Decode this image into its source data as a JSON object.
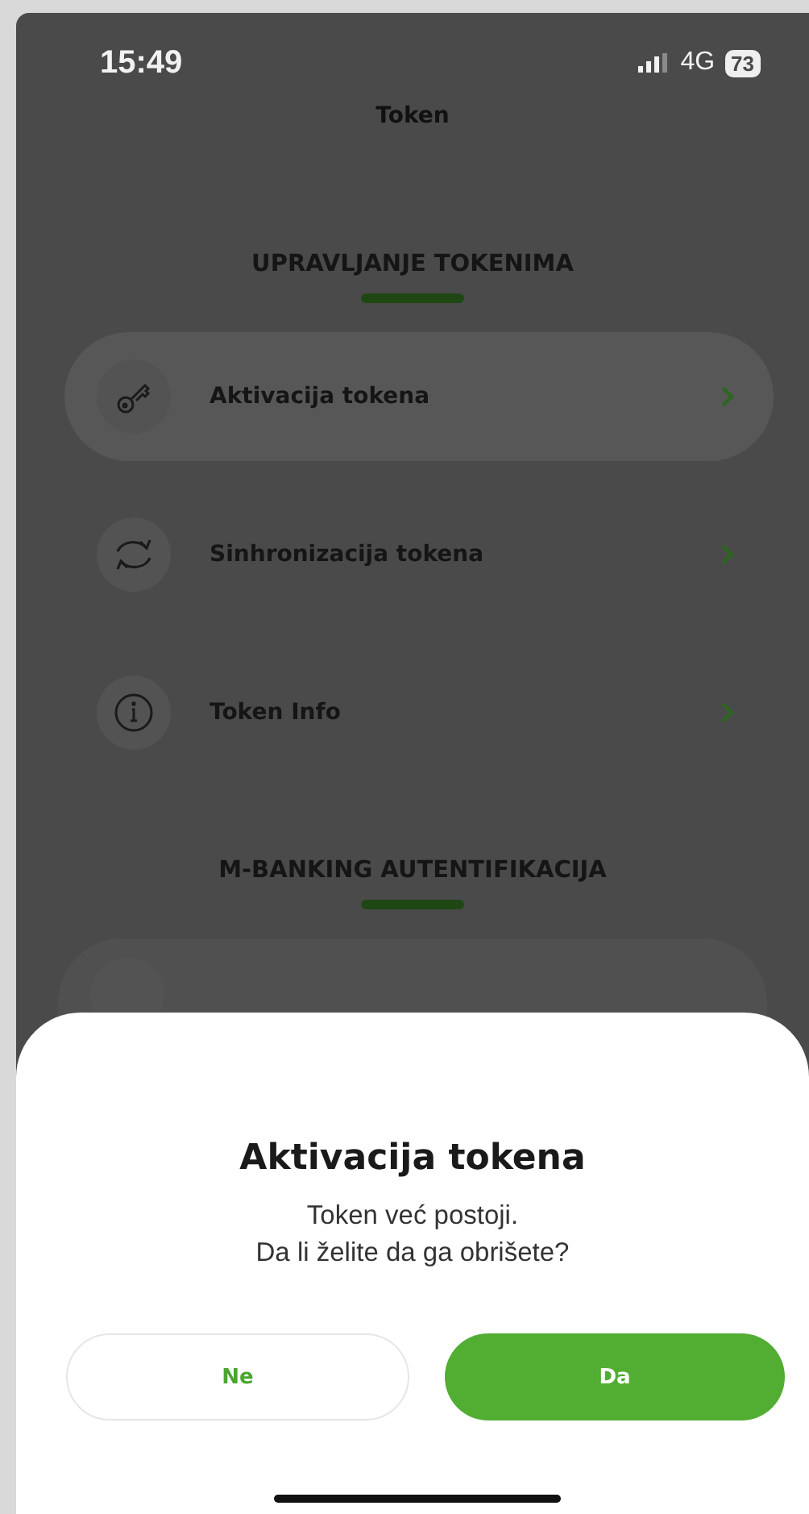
{
  "status_bar": {
    "time": "15:49",
    "network": "4G",
    "battery": "73"
  },
  "header": {
    "title": "Token"
  },
  "sections": [
    {
      "title": "UPRAVLJANJE TOKENIMA",
      "items": [
        {
          "kind": "key",
          "label": "Aktivacija tokena",
          "selected": true
        },
        {
          "kind": "sync",
          "label": "Sinhronizacija tokena",
          "selected": false
        },
        {
          "kind": "info",
          "label": "Token Info",
          "selected": false
        }
      ]
    },
    {
      "title": "M-BANKING AUTENTIFIKACIJA"
    }
  ],
  "dialog": {
    "title": "Aktivacija tokena",
    "message_lines": [
      "Token već postoji.",
      "Da li želite da ga obrišete?"
    ],
    "buttons": [
      {
        "kind": "secondary",
        "label": "Ne"
      },
      {
        "kind": "primary",
        "label": "Da"
      }
    ]
  }
}
